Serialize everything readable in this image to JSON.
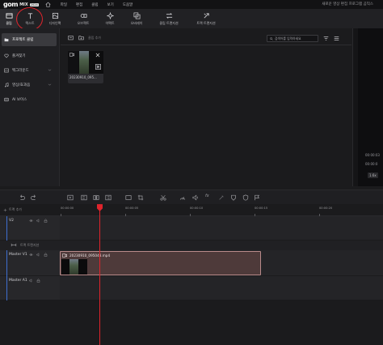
{
  "app": {
    "logo": "gom",
    "name": "MIX",
    "version": "2024",
    "project_title": "새로운 영상 편집 프로그램 곰믹스"
  },
  "menu": [
    "파일",
    "편집",
    "클립",
    "보기",
    "도움말"
  ],
  "tabs": [
    {
      "label": "클립",
      "icon": "film-icon",
      "active": true
    },
    {
      "label": "텍스트",
      "icon": "text-icon",
      "active": false
    },
    {
      "label": "디자인팩",
      "icon": "design-pack-icon",
      "active": false
    },
    {
      "label": "오브젝트",
      "icon": "object-icon",
      "active": false
    },
    {
      "label": "이펙트",
      "icon": "effect-icon",
      "active": false
    },
    {
      "label": "오버레이",
      "icon": "overlay-icon",
      "active": false
    },
    {
      "label": "클립 트랜지션",
      "icon": "clip-transition-icon",
      "active": false
    },
    {
      "label": "트랙 트랜지션",
      "icon": "track-transition-icon",
      "active": false
    }
  ],
  "sidebar": {
    "items": [
      {
        "label": "프로젝트 클립",
        "icon": "folder-icon",
        "active": true
      },
      {
        "label": "즐겨찾기",
        "icon": "heart-icon",
        "active": false
      },
      {
        "label": "백그라운드",
        "icon": "image-icon",
        "active": false,
        "expandable": true
      },
      {
        "label": "영상/효과음",
        "icon": "music-icon",
        "active": false,
        "expandable": true
      },
      {
        "label": "AI 보이스",
        "icon": "ai-voice-icon",
        "active": false
      }
    ]
  },
  "media": {
    "add_label": "클립 추가",
    "search_placeholder": "검색어를 입력하세요",
    "clips": [
      {
        "name": "20230910_095..."
      }
    ]
  },
  "preview": {
    "timecode_current": "00:00:03",
    "timecode_total": "00:00:0",
    "zoom": "1.6x"
  },
  "timeline": {
    "header_title": "트랙 추가",
    "ruler_labels": [
      "00:00:00",
      "00:00:05",
      "00:00:10",
      "00:00:15",
      "00:00:20"
    ],
    "transition_label": "트랙 트랜지션",
    "tracks": [
      {
        "name": "V2"
      },
      {
        "name": "Master V1"
      },
      {
        "name": "Master A1"
      }
    ],
    "clip_label": "20230910_095048.mp4"
  },
  "colors": {
    "accent_red": "#e0242c",
    "track_blue": "#3e6fd1",
    "clip_bg": "#4e3a3a"
  }
}
